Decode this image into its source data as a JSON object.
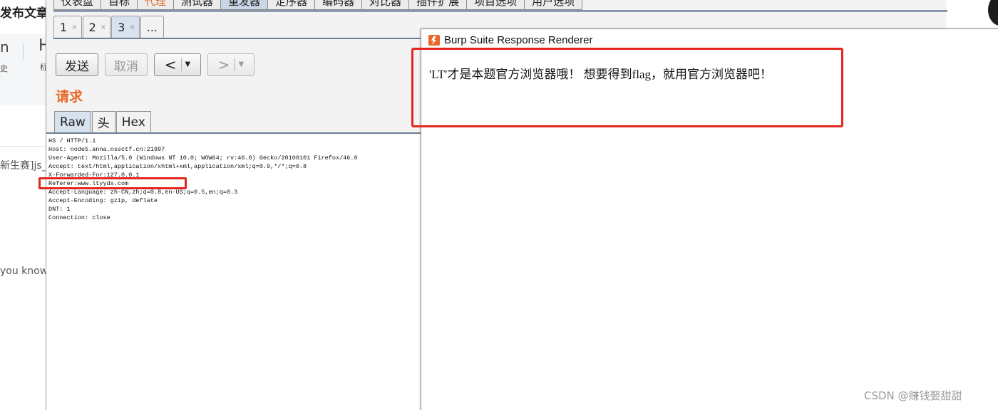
{
  "background_page": {
    "title": "发布文章",
    "icon_h": "H",
    "side_a": "n",
    "side_b": "史",
    "side_c": "标",
    "text_1": "新生赛]js_",
    "text_2": "you know"
  },
  "burp": {
    "main_tabs": [
      {
        "label": "仪表盘",
        "state": "normal"
      },
      {
        "label": "目标",
        "state": "normal"
      },
      {
        "label": "代理",
        "state": "orange"
      },
      {
        "label": "测试器",
        "state": "normal"
      },
      {
        "label": "重发器",
        "state": "active"
      },
      {
        "label": "定序器",
        "state": "normal"
      },
      {
        "label": "编码器",
        "state": "normal"
      },
      {
        "label": "对比器",
        "state": "normal"
      },
      {
        "label": "插件扩展",
        "state": "normal"
      },
      {
        "label": "项目选项",
        "state": "normal"
      },
      {
        "label": "用户选项",
        "state": "normal"
      }
    ],
    "sub_tabs": [
      {
        "num": "1",
        "close": "×"
      },
      {
        "num": "2",
        "close": "×"
      },
      {
        "num": "3",
        "close": "×"
      }
    ],
    "sub_more": "...",
    "send_label": "发送",
    "cancel_label": "取消",
    "back_glyph": "<",
    "forward_glyph": ">",
    "dropdown_glyph": "▼",
    "request_title": "请求",
    "view_tabs": [
      "Raw",
      "头",
      "Hex"
    ],
    "request_lines": [
      "HS / HTTP/1.1",
      "Host: node5.anna.nssctf.cn:21997",
      "User-Agent: Mozilla/5.0 (Windows NT 10.0; WOW64; rv:46.0) Gecko/20100101 Firefox/46.0",
      "Accept: text/html,application/xhtml+xml,application/xml;q=0.9,*/*;q=0.8",
      "X-Forwarded-For:127.0.0.1",
      "Referer:www.ltyyds.com",
      "Accept-Language: zh-CN,zh;q=0.8,en-US;q=0.5,en;q=0.3",
      "Accept-Encoding: gzip, deflate",
      "DNT: 1",
      "Connection: close"
    ]
  },
  "renderer": {
    "title": "Burp Suite Response Renderer",
    "content": "'LT'才是本题官方浏览器哦！ 想要得到flag，就用官方浏览器吧！"
  },
  "colors": {
    "highlight_red": "#e3261f",
    "burp_orange": "#e8682a",
    "active_tab_blue": "#c9d6e8"
  },
  "watermark": "CSDN @赚钱娶甜甜"
}
